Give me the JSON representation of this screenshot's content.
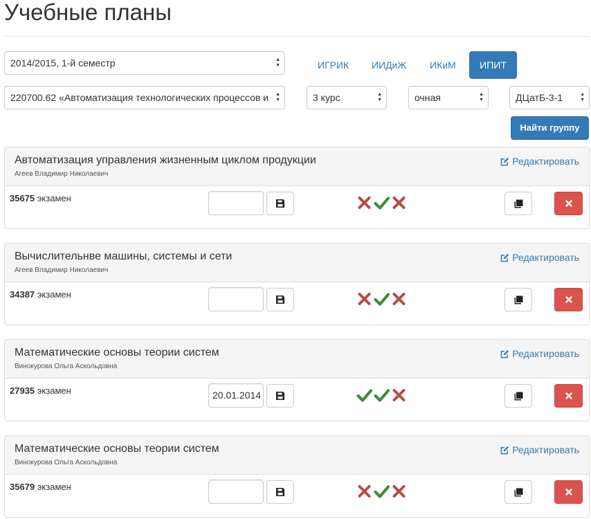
{
  "page": {
    "title": "Учебные планы"
  },
  "filters": {
    "semester": "2014/2015, 1-й семестр",
    "specialty": "220700.62 «Автоматизация технологических процессов и",
    "course": "3 курс",
    "form": "очная",
    "group": "ДЦатБ-3-1",
    "find_label": "Найти группу"
  },
  "institutes": [
    {
      "label": "ИГРИК",
      "active": false
    },
    {
      "label": "ИИДиЖ",
      "active": false
    },
    {
      "label": "ИКиМ",
      "active": false
    },
    {
      "label": "ИПИТ",
      "active": true
    }
  ],
  "edit_label": "Редактировать",
  "colors": {
    "primary": "#337ab7",
    "danger": "#d9534f",
    "check": "#3c8d3c",
    "cross": "#b94a48"
  },
  "panels": [
    {
      "title": "Автоматизация управления жизненным циклом продукции",
      "teacher": "Агеев Владимир Николаевич",
      "id": "35675",
      "type": "экзамен",
      "date": "",
      "marks": [
        "cross",
        "check",
        "cross"
      ]
    },
    {
      "title": "Вычислительнве машины, системы и сети",
      "teacher": "Агеев Владимир Николаевич",
      "id": "34387",
      "type": "экзамен",
      "date": "",
      "marks": [
        "cross",
        "check",
        "cross"
      ]
    },
    {
      "title": "Математические основы теории систем",
      "teacher": "Винокурова Ольга Аскольдовна",
      "id": "27935",
      "type": "экзамен",
      "date": "20.01.2014",
      "marks": [
        "check",
        "check",
        "cross"
      ]
    },
    {
      "title": "Математические основы теории систем",
      "teacher": "Винокурова Ольга Аскольдовна",
      "id": "35679",
      "type": "экзамен",
      "date": "",
      "marks": [
        "cross",
        "check",
        "cross"
      ]
    }
  ]
}
